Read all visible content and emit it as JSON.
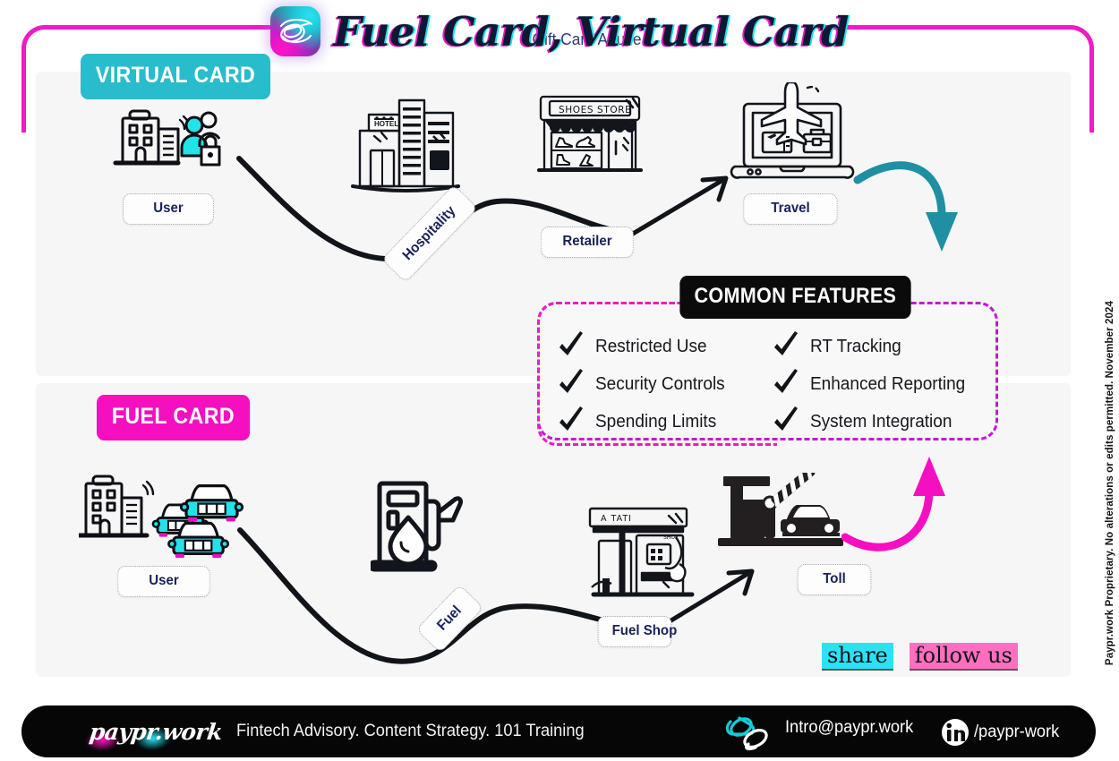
{
  "header": {
    "title": "Fuel Card, Virtual Card",
    "logo_icon": "paypr-scribble-logo"
  },
  "sections": [
    {
      "id": "virtual",
      "badge": "VIRTUAL CARD",
      "badge_color": "#29bccd"
    },
    {
      "id": "fuel",
      "badge": "FUEL CARD",
      "badge_color": "#f50fc1"
    }
  ],
  "virtual_flow": {
    "nodes": [
      {
        "label": "User",
        "icon": "office-building-people-lock-icon"
      },
      {
        "label": "Hospitality",
        "icon": "hotel-buildings-icon",
        "rotated": true
      },
      {
        "label": "Retailer",
        "icon": "shoes-store-icon"
      },
      {
        "label": "Travel",
        "icon": "laptop-airplane-ticket-icon"
      }
    ],
    "store_sign": "SHOES STORE",
    "hotel_sign": "HOTEL",
    "arrow_color": "#1f8fa3"
  },
  "fuel_flow": {
    "nodes": [
      {
        "label": "User",
        "icon": "office-building-fleet-cars-icon"
      },
      {
        "label": "Fuel",
        "icon": "fuel-pump-icon",
        "rotated": true
      },
      {
        "label": "Fuel Shop",
        "icon": "gas-station-shop-icon"
      },
      {
        "label": "Toll",
        "icon": "toll-booth-car-icon"
      }
    ],
    "station_sign": "A TATI",
    "station_shop": "SHOP",
    "arrow_color": "#f50fc1"
  },
  "features": {
    "title": "COMMON FEATURES",
    "border_colors": {
      "left": "#ec1bc6",
      "right": "#c31ad6"
    },
    "columns": [
      [
        "Restricted Use",
        "Security Controls",
        "Spending Limits"
      ],
      [
        "RT Tracking",
        "Enhanced Reporting",
        "System Integration"
      ]
    ]
  },
  "social": {
    "share_label": "share",
    "share_highlight": "#2ce0f5",
    "follow_label": "follow us",
    "follow_highlight": "#ff6fc0"
  },
  "legal": "Paypr.work Proprietary. No alterations or edits permitted. November 2024",
  "footer": {
    "brand": "paypr.work",
    "tagline": "Fintech Advisory. Content Strategy. 101 Training",
    "watermark": "Gift Card Abuse",
    "email": "Intro@paypr.work",
    "email_icon": "paperclip-icon",
    "linkedin_icon": "linkedin-icon",
    "linkedin_handle": "/paypr-work"
  }
}
